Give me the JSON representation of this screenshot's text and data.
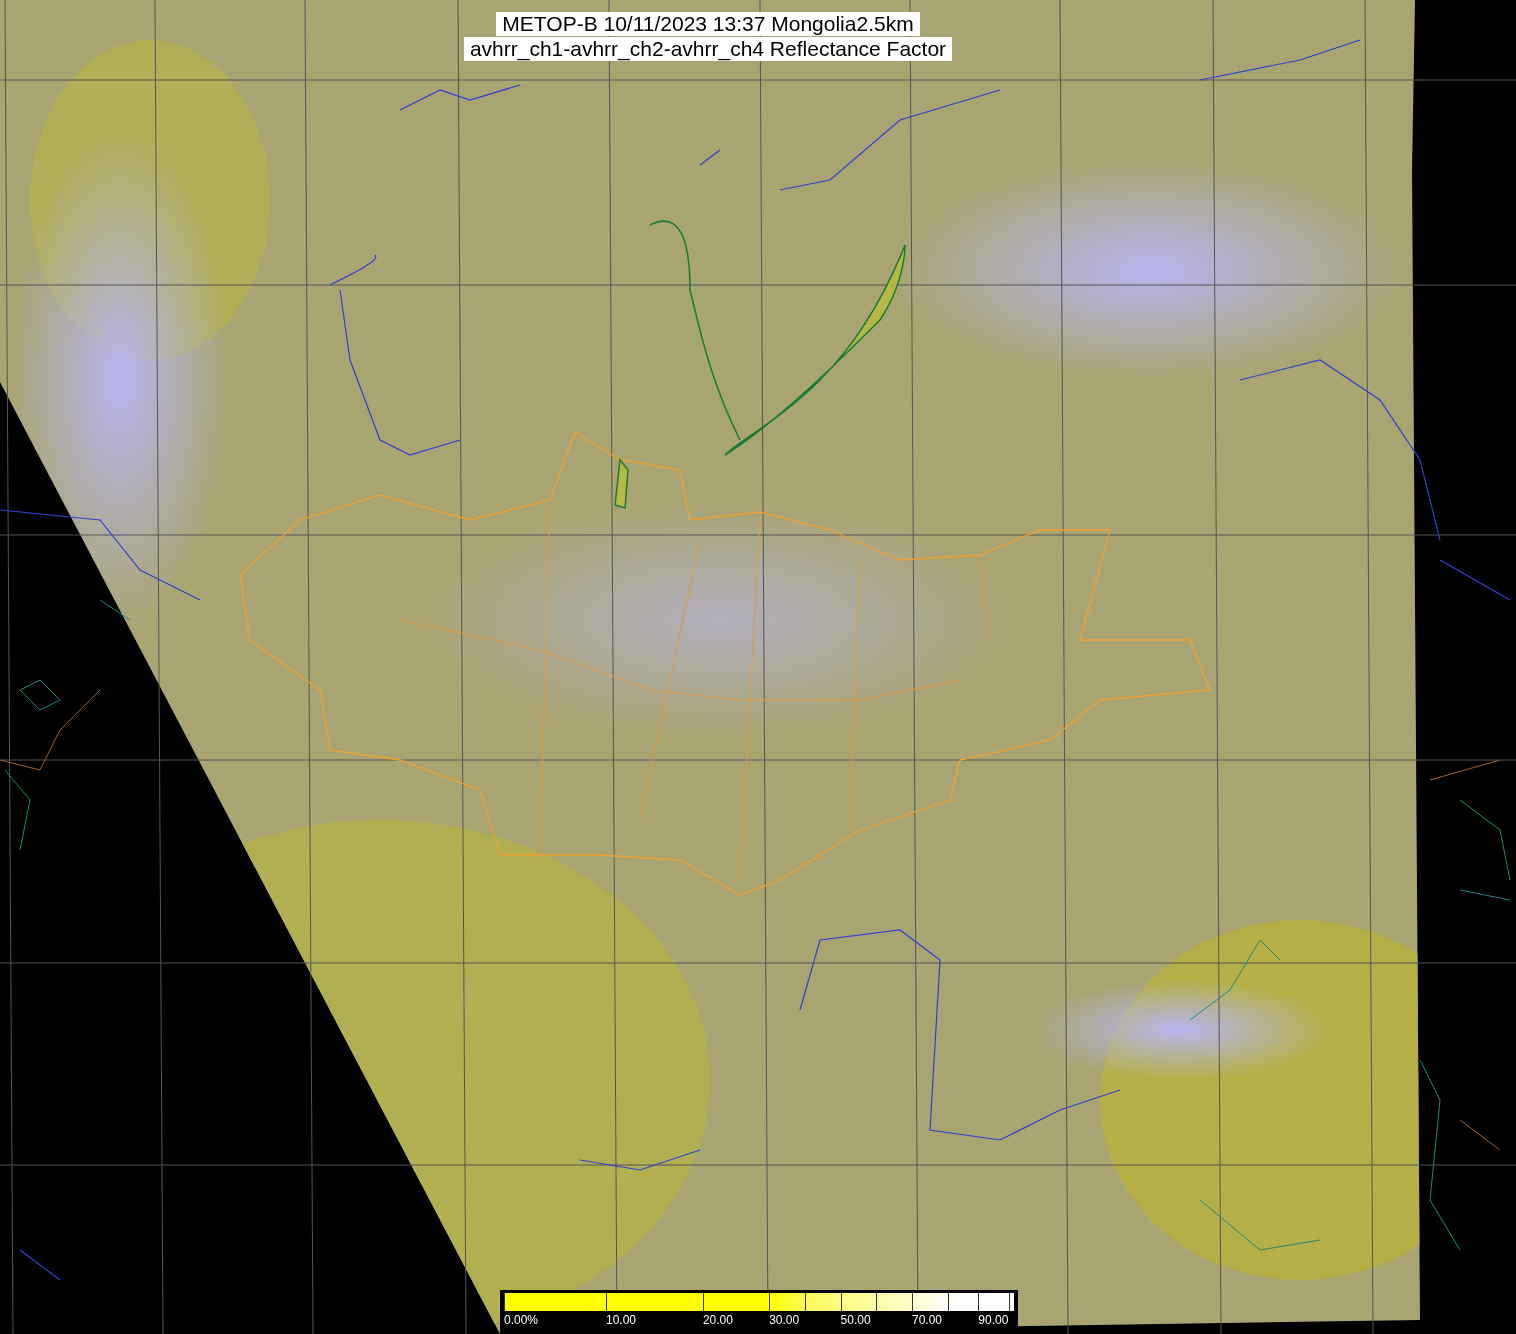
{
  "title": {
    "lines": [
      "METOP-B 10/11/2023 13:37 Mongolia2.5km",
      "avhrr_ch1-avhrr_ch2-avhrr_ch4 Reflectance Factor"
    ]
  },
  "legend": {
    "labels": [
      "0.00%",
      "10.00",
      "20.00",
      "30.00",
      "50.00",
      "70.00",
      "90.00"
    ]
  }
}
